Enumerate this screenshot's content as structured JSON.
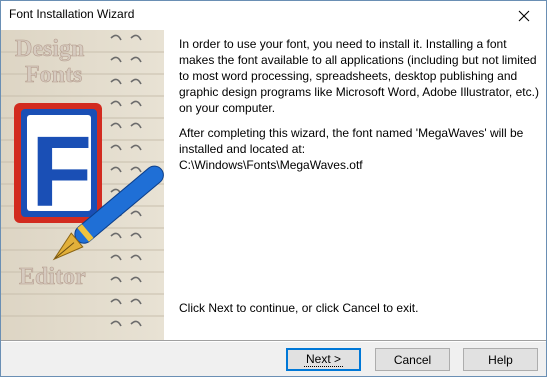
{
  "window": {
    "title": "Font Installation Wizard"
  },
  "side_image": {
    "logo_lines": [
      "Design",
      "Fonts",
      "Editor"
    ],
    "logo_letter": "F"
  },
  "body": {
    "paragraph1": "In order to use your font, you need to install it. Installing a font makes the font available to all applications (including but not limited to most word processing, spreadsheets, desktop publishing and graphic design programs like Microsoft Word, Adobe Illustrator, etc.) on your computer.",
    "paragraph2": "After completing this wizard, the font named 'MegaWaves' will be installed and located at:",
    "install_path": "C:\\Windows\\Fonts\\MegaWaves.otf",
    "instruction": "Click Next to continue, or click Cancel to exit."
  },
  "buttons": {
    "next": "Next >",
    "cancel": "Cancel",
    "help": "Help"
  },
  "colors": {
    "accent": "#0078d7",
    "logo_blue": "#1a4fb5",
    "logo_red": "#d22b1f"
  }
}
